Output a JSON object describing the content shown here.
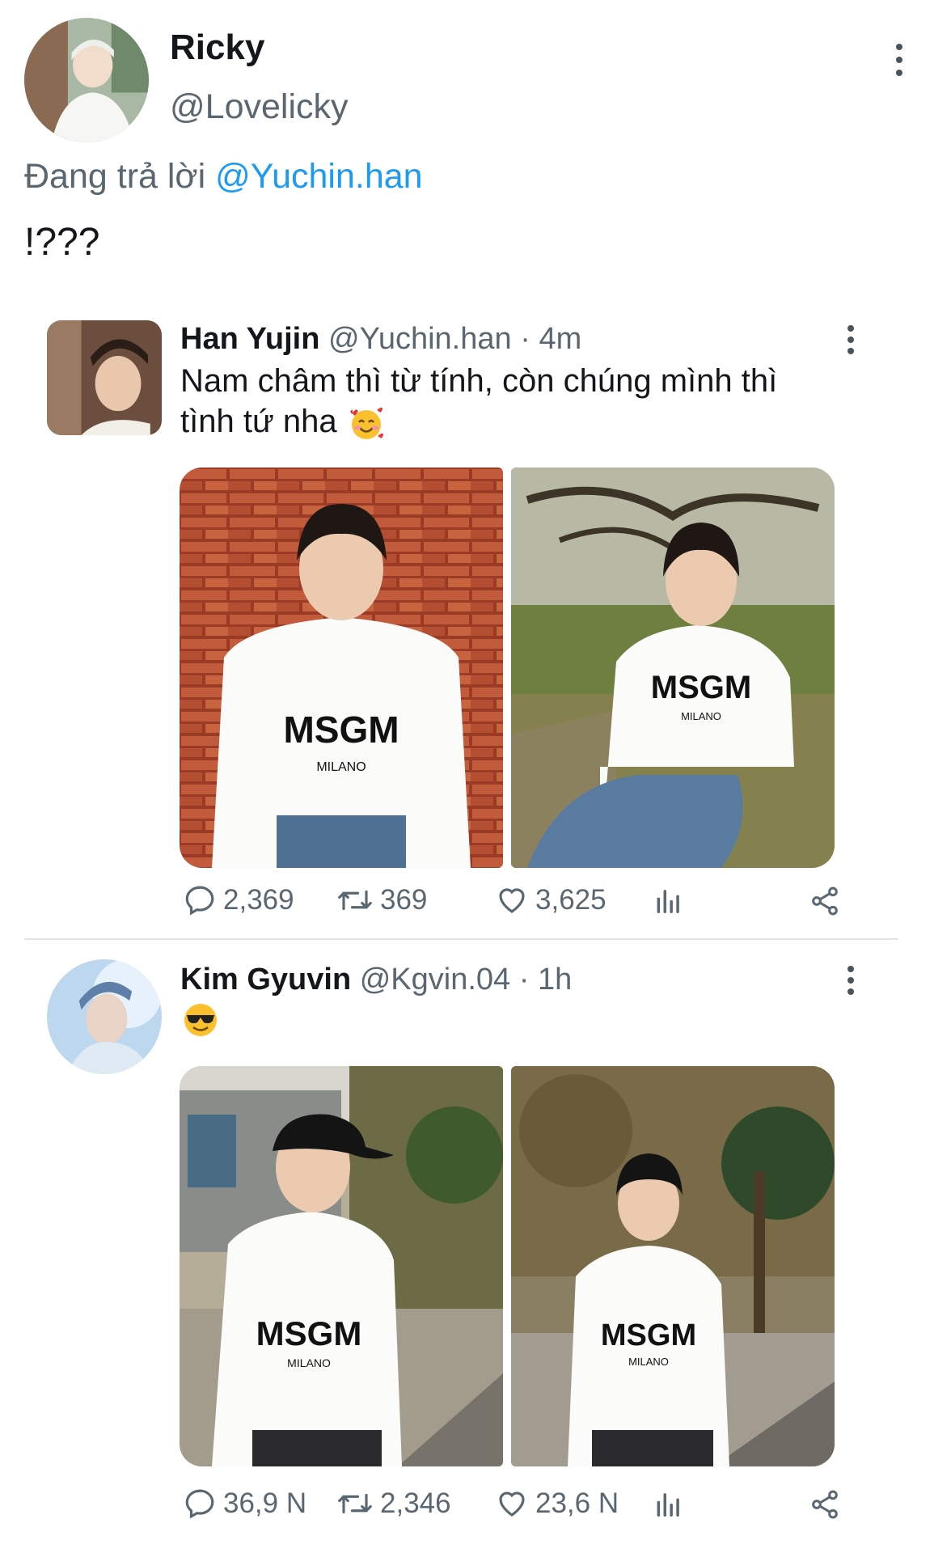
{
  "main_tweet": {
    "name": "Ricky",
    "handle": "@Lovelicky",
    "replying_to_prefix": "Đang trả lời",
    "replying_to_handle": "@Yuchin.han",
    "text": "!???"
  },
  "quoted_tweets": [
    {
      "name": "Han Yujin",
      "handle": "@Yuchin.han",
      "separator": "·",
      "time": "4m",
      "text_line1": "Nam châm thì từ tính, còn chúng mình thì",
      "text_line2": "tình tứ nha",
      "emoji": "smiling-face-with-hearts",
      "photo_shirt_text": "MSGM",
      "photo_shirt_sub": "MILANO",
      "stats": {
        "replies": "2,369",
        "retweets": "369",
        "likes": "3,625"
      }
    },
    {
      "name": "Kim Gyuvin",
      "handle": "@Kgvin.04",
      "separator": "·",
      "time": "1h",
      "emoji": "smiling-face-with-sunglasses",
      "photo_shirt_text": "MSGM",
      "photo_shirt_sub": "MILANO",
      "stats": {
        "replies": "36,9 N",
        "retweets": "2,346",
        "likes": "23,6 N"
      }
    }
  ],
  "colors": {
    "link": "#1d9bf0",
    "muted": "#5b6770",
    "text": "#14171a",
    "divider": "#e3e6e8"
  }
}
